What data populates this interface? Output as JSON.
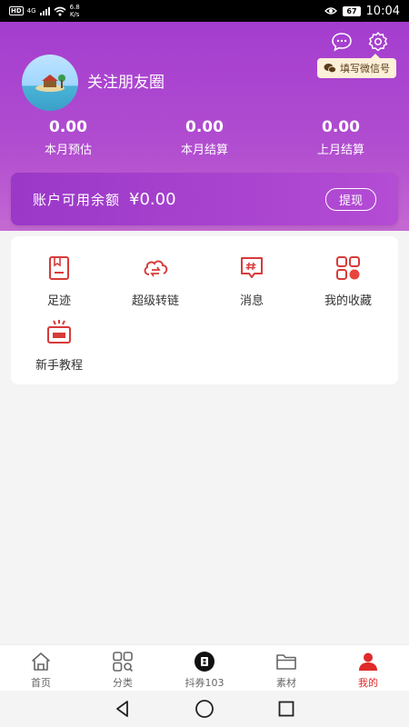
{
  "status_bar": {
    "network": "4G",
    "speed": "6.8",
    "speed_unit": "K/s",
    "battery": "67",
    "time": "10:04"
  },
  "header": {
    "username": "关注朋友圈",
    "wechat_tip": "填写微信号"
  },
  "stats": [
    {
      "value": "0.00",
      "label": "本月预估"
    },
    {
      "value": "0.00",
      "label": "本月结算"
    },
    {
      "value": "0.00",
      "label": "上月结算"
    }
  ],
  "balance": {
    "label": "账户可用余额",
    "value": "¥0.00",
    "withdraw_label": "提现"
  },
  "menu": [
    {
      "label": "足迹",
      "icon": "footprint-icon"
    },
    {
      "label": "超级转链",
      "icon": "link-convert-icon"
    },
    {
      "label": "消息",
      "icon": "message-icon"
    },
    {
      "label": "我的收藏",
      "icon": "favorites-icon"
    },
    {
      "label": "新手教程",
      "icon": "tutorial-icon"
    }
  ],
  "tabs": [
    {
      "label": "首页",
      "icon": "home-icon"
    },
    {
      "label": "分类",
      "icon": "category-icon"
    },
    {
      "label": "抖券103",
      "icon": "douquan-icon"
    },
    {
      "label": "素材",
      "icon": "folder-icon"
    },
    {
      "label": "我的",
      "icon": "profile-icon",
      "active": true
    }
  ],
  "colors": {
    "primary": "#a43dcf",
    "accent": "#e02a2a",
    "icon_red": "#d93a3a"
  }
}
